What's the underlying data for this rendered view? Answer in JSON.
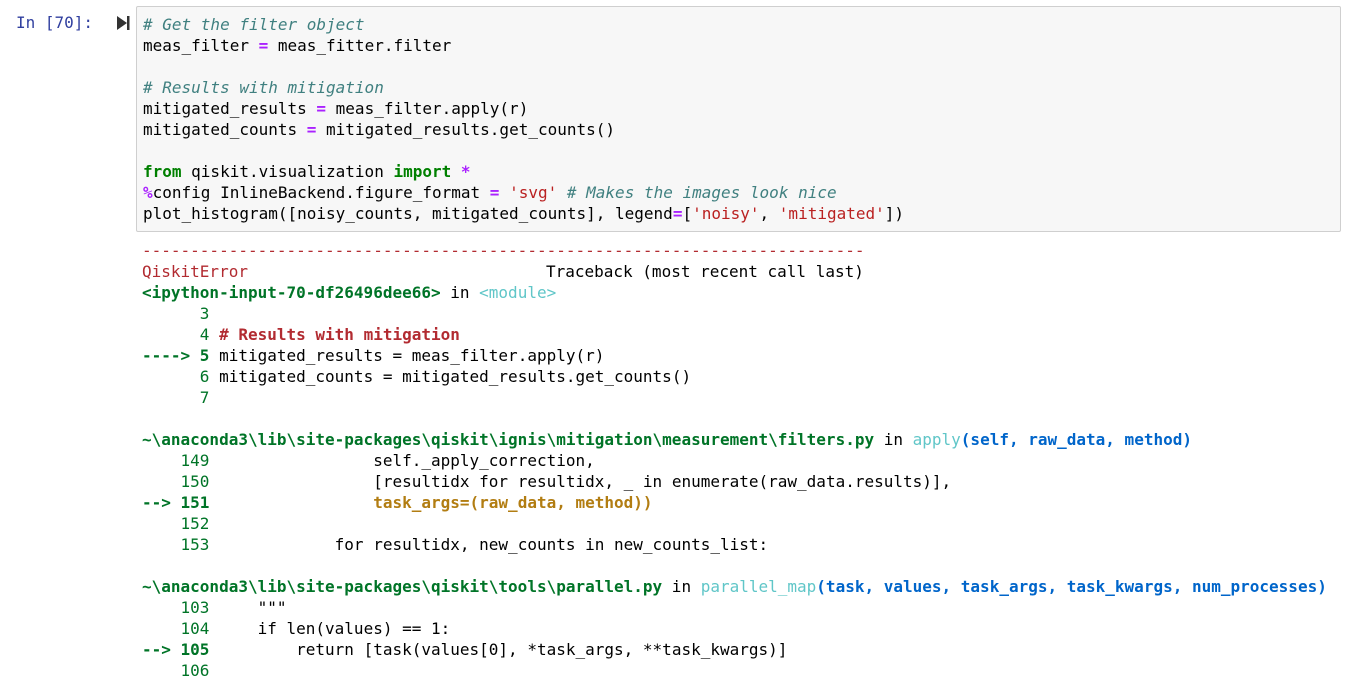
{
  "cell": {
    "prompt": "In [70]:",
    "code_lines": [
      {
        "comment": "# Get the filter object"
      },
      {
        "a": "meas_filter ",
        "eq": "=",
        "b": " meas_fitter.filter"
      },
      {},
      {
        "comment": "# Results with mitigation"
      },
      {
        "a": "mitigated_results ",
        "eq": "=",
        "b": " meas_filter.apply(r)"
      },
      {
        "a": "mitigated_counts ",
        "eq": "=",
        "b": " mitigated_results.get_counts()"
      },
      {},
      {
        "kw1": "from",
        "mid": " qiskit.visualization ",
        "kw2": "import",
        "sp": " ",
        "star": "*"
      },
      {
        "pct": "%",
        "a": "config InlineBackend.figure_format ",
        "eq": "=",
        "sp": " ",
        "str": "'svg'",
        "sp2": " ",
        "comment": "# Makes the images look nice"
      },
      {
        "a": "plot_histogram([noisy_counts, mitigated_counts], legend",
        "eq": "=",
        "b": "[",
        "s1": "'noisy'",
        "c": ", ",
        "s2": "'mitigated'",
        "d": "])"
      }
    ]
  },
  "traceback": {
    "separator": "---------------------------------------------------------------------------",
    "error_name": "QiskitError",
    "header_right": "Traceback (most recent call last)",
    "frame1": {
      "location": "<ipython-input-70-df26496dee66>",
      "in": " in ",
      "func": "<module>",
      "lines": [
        {
          "no": "      3",
          "code": ""
        },
        {
          "no": "      4",
          "code": " # Results with mitigation"
        },
        {
          "arrow": "----> 5",
          "code": " mitigated_results = meas_filter.apply(r)"
        },
        {
          "no": "      6",
          "code": " mitigated_counts = mitigated_results.get_counts()"
        },
        {
          "no": "      7",
          "code": ""
        }
      ]
    },
    "frame2": {
      "path": "~\\anaconda3\\lib\\site-packages\\qiskit\\ignis\\mitigation\\measurement\\filters.py",
      "in": " in ",
      "func": "apply",
      "args": "(self, raw_data, method)",
      "lines": [
        {
          "no": "    149",
          "code": "                 self._apply_correction,"
        },
        {
          "no": "    150",
          "code": "                 [resultidx for resultidx, _ in enumerate(raw_data.results)],"
        },
        {
          "arrow": "--> 151",
          "code": "                 task_args=(raw_data, method))"
        },
        {
          "no": "    152",
          "code": ""
        },
        {
          "no": "    153",
          "code": "             for resultidx, new_counts in new_counts_list:"
        }
      ]
    },
    "frame3": {
      "path": "~\\anaconda3\\lib\\site-packages\\qiskit\\tools\\parallel.py",
      "in": " in ",
      "func": "parallel_map",
      "args": "(task, values, task_args, task_kwargs, num_processes)",
      "lines": [
        {
          "no": "    103",
          "code": "     \"\"\""
        },
        {
          "no": "    104",
          "code": "     if len(values) == 1:"
        },
        {
          "arrow": "--> 105",
          "code": "         return [task(values[0], *task_args, **task_kwargs)]"
        },
        {
          "no": "    106",
          "code": ""
        }
      ]
    }
  }
}
